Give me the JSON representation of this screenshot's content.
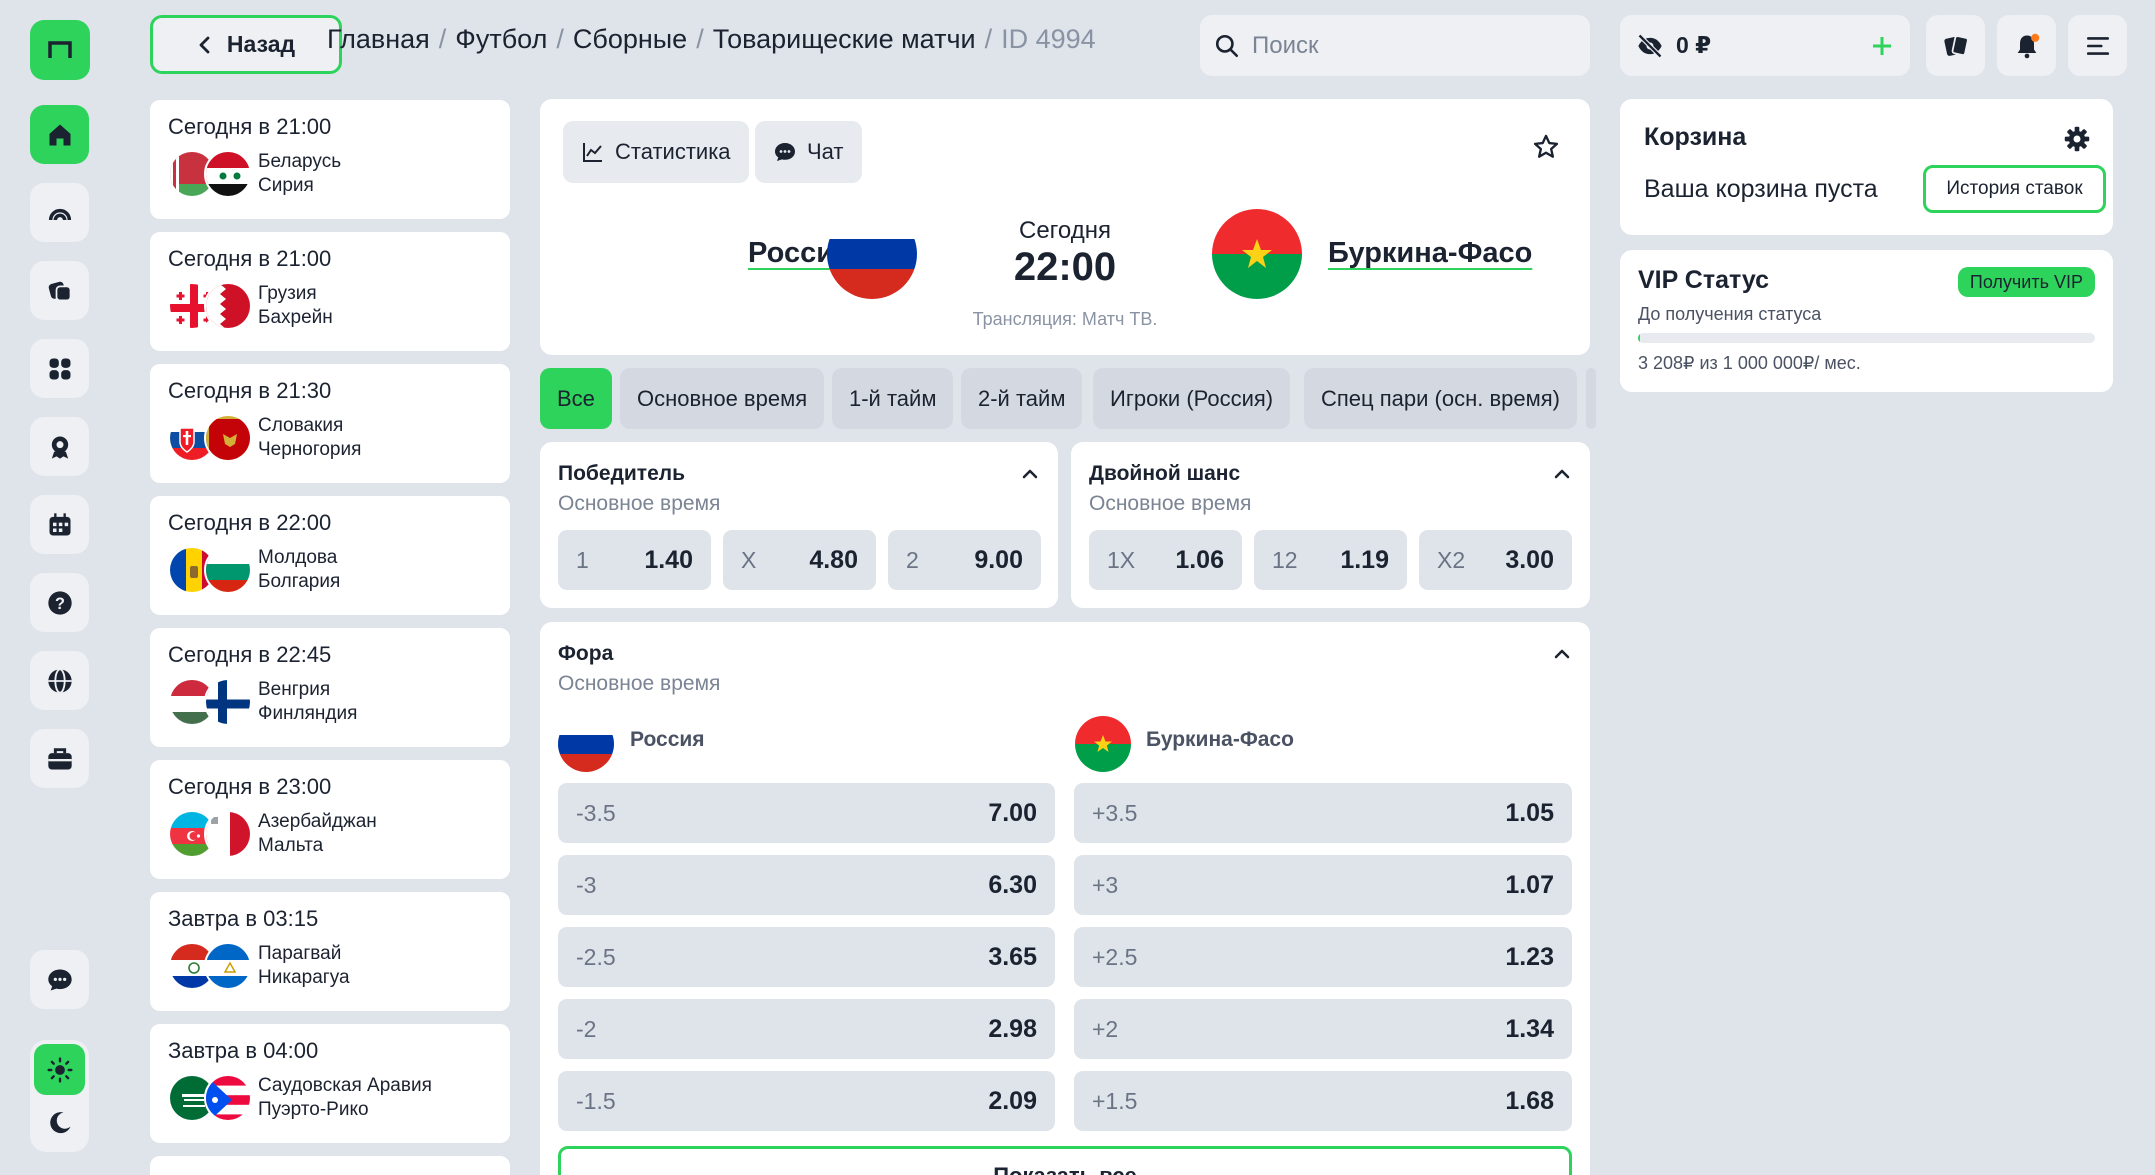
{
  "header": {
    "back_label": "Назад",
    "breadcrumbs": [
      "Главная",
      "Футбол",
      "Сборные",
      "Товарищеские матчи"
    ],
    "match_id": "ID 4994",
    "search_placeholder": "Поиск",
    "balance": "0 ₽"
  },
  "match_list": [
    {
      "time": "Сегодня в 21:00",
      "team1": "Беларусь",
      "team2": "Сирия"
    },
    {
      "time": "Сегодня в 21:00",
      "team1": "Грузия",
      "team2": "Бахрейн"
    },
    {
      "time": "Сегодня в 21:30",
      "team1": "Словакия",
      "team2": "Черногория"
    },
    {
      "time": "Сегодня в 22:00",
      "team1": "Молдова",
      "team2": "Болгария"
    },
    {
      "time": "Сегодня в 22:45",
      "team1": "Венгрия",
      "team2": "Финляндия"
    },
    {
      "time": "Сегодня в 23:00",
      "team1": "Азербайджан",
      "team2": "Мальта"
    },
    {
      "time": "Завтра в 03:15",
      "team1": "Парагвай",
      "team2": "Никарагуа"
    },
    {
      "time": "Завтра в 04:00",
      "team1": "Саудовская Аравия",
      "team2": "Пуэрто-Рико"
    }
  ],
  "match": {
    "tab_stats": "Статистика",
    "tab_chat": "Чат",
    "home": "Россия",
    "away": "Буркина-Фасо",
    "day": "Сегодня",
    "time": "22:00",
    "broadcast": "Трансляция: Матч ТВ."
  },
  "filter_tabs": [
    "Все",
    "Основное время",
    "1-й тайм",
    "2-й тайм",
    "Игроки (Россия)",
    "Спец пари (осн. время)"
  ],
  "markets": {
    "winner": {
      "title": "Победитель",
      "subtitle": "Основное время",
      "odds": [
        {
          "label": "1",
          "value": "1.40"
        },
        {
          "label": "X",
          "value": "4.80"
        },
        {
          "label": "2",
          "value": "9.00"
        }
      ]
    },
    "double_chance": {
      "title": "Двойной шанс",
      "subtitle": "Основное время",
      "odds": [
        {
          "label": "1X",
          "value": "1.06"
        },
        {
          "label": "12",
          "value": "1.19"
        },
        {
          "label": "X2",
          "value": "3.00"
        }
      ]
    },
    "handicap": {
      "title": "Фора",
      "subtitle": "Основное время",
      "home": "Россия",
      "away": "Буркина-Фасо",
      "home_rows": [
        {
          "label": "-3.5",
          "value": "7.00"
        },
        {
          "label": "-3",
          "value": "6.30"
        },
        {
          "label": "-2.5",
          "value": "3.65"
        },
        {
          "label": "-2",
          "value": "2.98"
        },
        {
          "label": "-1.5",
          "value": "2.09"
        }
      ],
      "away_rows": [
        {
          "label": "+3.5",
          "value": "1.05"
        },
        {
          "label": "+3",
          "value": "1.07"
        },
        {
          "label": "+2.5",
          "value": "1.23"
        },
        {
          "label": "+2",
          "value": "1.34"
        },
        {
          "label": "+1.5",
          "value": "1.68"
        }
      ],
      "show_all": "Показать все"
    }
  },
  "cart": {
    "title": "Корзина",
    "empty_text": "Ваша корзина пуста",
    "history_button": "История ставок"
  },
  "vip": {
    "title": "VIP Статус",
    "button": "Получить VIP",
    "subtitle": "До получения статуса",
    "progress_text": "3 208₽ из 1 000 000₽/ мес.",
    "progress_fraction": 0.0032
  },
  "colors": {
    "accent": "#2ed35c",
    "background": "#dfe3ea"
  }
}
